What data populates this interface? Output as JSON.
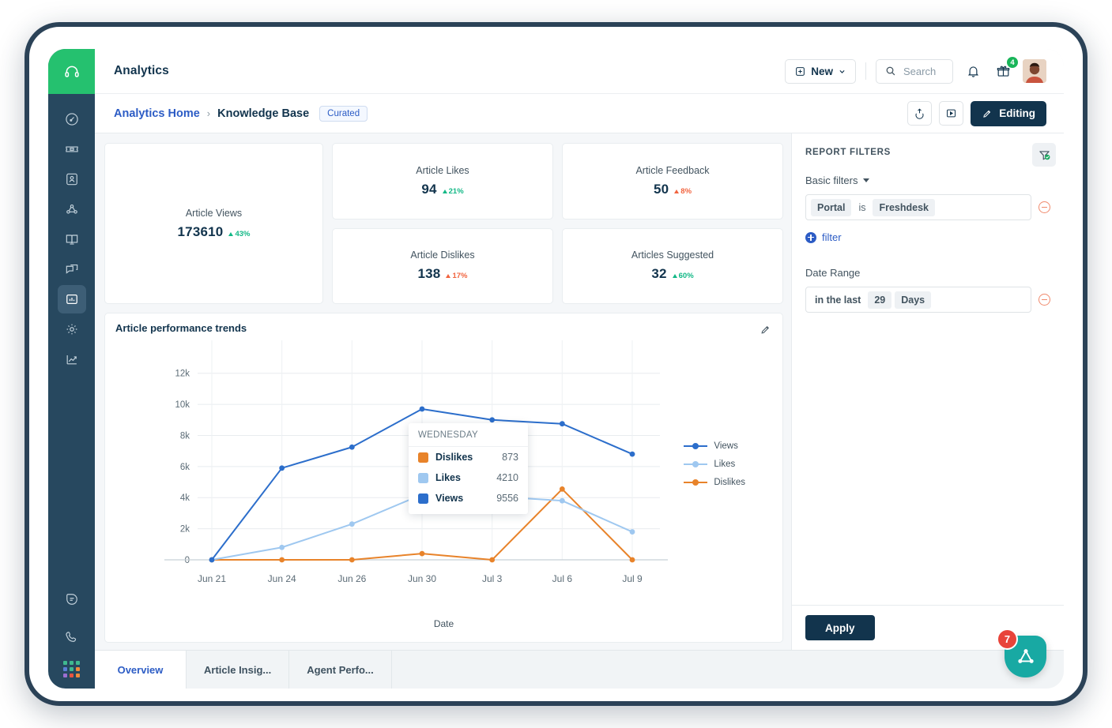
{
  "app": {
    "logo_icon": "headset-icon",
    "title": "Analytics",
    "brand_green": "#25c16f",
    "rail_bg": "#27485f"
  },
  "topbar": {
    "new_label": "New",
    "new_icon": "plus-square-icon",
    "chevron_icon": "chevron-down-icon",
    "search_placeholder": "Search",
    "search_icon": "search-icon",
    "bell_icon": "bell-icon",
    "gift_icon": "gift-icon",
    "gift_badge": "4",
    "avatar_icon": "user-avatar"
  },
  "breadcrumb": {
    "home": "Analytics Home",
    "separator": "›",
    "current": "Knowledge Base",
    "chip": "Curated",
    "export_icon": "export-icon",
    "present_icon": "present-play-icon",
    "editing_label": "Editing",
    "editing_icon": "pencil-icon"
  },
  "sidebar": {
    "items": [
      {
        "name": "dashboard",
        "icon": "gauge-icon",
        "active": false
      },
      {
        "name": "tickets",
        "icon": "ticket-icon",
        "active": false
      },
      {
        "name": "contacts",
        "icon": "contact-card-icon",
        "active": false
      },
      {
        "name": "social",
        "icon": "network-icon",
        "active": false
      },
      {
        "name": "knowledge-base",
        "icon": "book-icon",
        "active": false
      },
      {
        "name": "conversations",
        "icon": "chat-stack-icon",
        "active": false
      },
      {
        "name": "analytics",
        "icon": "bar-chart-icon",
        "active": true
      },
      {
        "name": "admin",
        "icon": "gear-icon",
        "active": false
      },
      {
        "name": "trends",
        "icon": "trend-up-icon",
        "active": false
      }
    ],
    "bottom": [
      {
        "name": "chat",
        "icon": "chat-bubble-icon"
      },
      {
        "name": "phone",
        "icon": "phone-icon"
      },
      {
        "name": "app-switcher",
        "icon": "app-grid-icon"
      }
    ]
  },
  "kpis": {
    "primary": {
      "label": "Article Views",
      "value": "173610",
      "delta": "43%",
      "direction": "up",
      "tone": "green"
    },
    "cards": [
      {
        "label": "Article Likes",
        "value": "94",
        "delta": "21%",
        "direction": "up",
        "tone": "green"
      },
      {
        "label": "Article Feedback",
        "value": "50",
        "delta": "8%",
        "direction": "up",
        "tone": "red"
      },
      {
        "label": "Article Dislikes",
        "value": "138",
        "delta": "17%",
        "direction": "up",
        "tone": "red"
      },
      {
        "label": "Articles Suggested",
        "value": "32",
        "delta": "60%",
        "direction": "up",
        "tone": "green"
      }
    ]
  },
  "chart_panel": {
    "title": "Article performance trends",
    "edit_icon": "pencil-icon"
  },
  "chart_data": {
    "type": "line",
    "title": "Article performance trends",
    "xlabel": "Date",
    "ylabel": "",
    "categories": [
      "Jun 21",
      "Jun 24",
      "Jun 26",
      "Jun 30",
      "Jul 3",
      "Jul 6",
      "Jul 9"
    ],
    "ylim": [
      0,
      13000
    ],
    "yticks": [
      0,
      2000,
      4000,
      6000,
      8000,
      10000,
      12000
    ],
    "ytick_labels": [
      "0",
      "2k",
      "4k",
      "6k",
      "8k",
      "10k",
      "12k"
    ],
    "grid": true,
    "legend_position": "right",
    "series": [
      {
        "name": "Views",
        "color": "#2c6ecb",
        "values": [
          0,
          5900,
          7250,
          9700,
          9000,
          8750,
          6800
        ]
      },
      {
        "name": "Likes",
        "color": "#9fc8f0",
        "values": [
          0,
          800,
          2300,
          4200,
          4080,
          3800,
          1800
        ]
      },
      {
        "name": "Dislikes",
        "color": "#e8832a",
        "values": [
          0,
          0,
          0,
          400,
          0,
          4550,
          0
        ]
      }
    ],
    "tooltip": {
      "title": "WEDNESDAY",
      "rows": [
        {
          "label": "Dislikes",
          "value": "873",
          "color": "#e8832a"
        },
        {
          "label": "Likes",
          "value": "4210",
          "color": "#9fc8f0"
        },
        {
          "label": "Views",
          "value": "9556",
          "color": "#2c6ecb"
        }
      ]
    }
  },
  "filters": {
    "heading": "REPORT FILTERS",
    "basic_label": "Basic filters",
    "rows": [
      {
        "field": "Portal",
        "operator": "is",
        "value": "Freshdesk"
      }
    ],
    "add_label": "filter",
    "date_range_label": "Date Range",
    "date_range": {
      "operator": "in the last",
      "amount": "29",
      "unit": "Days"
    },
    "apply_label": "Apply",
    "tab_icon": "filter-check-icon"
  },
  "tabs": [
    {
      "label": "Overview",
      "active": true
    },
    {
      "label": "Article Insig...",
      "active": false
    },
    {
      "label": "Agent Perfo...",
      "active": false
    }
  ],
  "fab": {
    "icon": "freshworks-icon",
    "badge": "7",
    "color": "#18a9a3"
  }
}
